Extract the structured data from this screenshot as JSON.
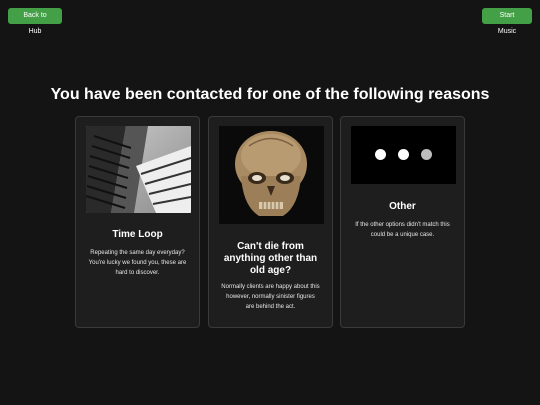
{
  "header": {
    "back_label": "Back to Hub",
    "music_label": "Start Music"
  },
  "main": {
    "heading": "You have been contacted for one of the following reasons"
  },
  "cards": [
    {
      "title": "Time Loop",
      "description": "Repeating the same day everyday? You're lucky we found you, these are hard to discover.",
      "image": "staircase-photo"
    },
    {
      "title": "Can't die from anything other than old age?",
      "description": "Normally clients are happy about this however, normally sinister figures are behind the act.",
      "image": "skull-photo"
    },
    {
      "title": "Other",
      "description": "If the other options didn't match this could be a unique case.",
      "image": "three-dots"
    }
  ],
  "colors": {
    "background": "#141414",
    "card": "#1e1e1e",
    "button": "#43a047"
  }
}
